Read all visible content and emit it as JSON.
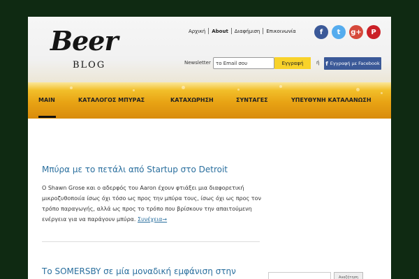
{
  "logo": {
    "main": "Beer",
    "sub": "BLOG"
  },
  "top_nav": {
    "items": [
      "Αρχική",
      "About",
      "Διαφήμιση",
      "Επικοινωνία"
    ],
    "active": "About"
  },
  "social": {
    "facebook": "f",
    "twitter": "t",
    "google_plus": "g+",
    "pinterest": "P"
  },
  "newsletter": {
    "label": "Newsletter",
    "email_value": "το Email σου",
    "register_label": "Εγγραφή",
    "or_label": "ή",
    "facebook_register_label": "Εγγραφή με Facebook"
  },
  "main_nav": {
    "items": [
      "MAIN",
      "ΚΑΤΑΛΟΓΟΣ ΜΠΥΡΑΣ",
      "ΚΑΤΑΧΩΡΗΣΗ",
      "ΣΥΝΤΑΓΕΣ",
      "ΥΠΕΥΘΥΝΗ ΚΑΤΑΛΑΝΩΣΗ"
    ],
    "active": "MAIN"
  },
  "post": {
    "title": "Μπύρα με το πετάλι από Startup στο Detroit",
    "excerpt": "Ο Shawn Grose και ο αδερφός του Aaron έχουν φτιάξει μια διαφορετική μικροζυθοποιία ίσως όχι τόσο ως προς την μπύρα τους, ίσως όχι ως προς τον τρόπο παραγωγής, αλλά ως προς το τρόπο που βρίσκουν την απαιτούμενη ενέργεια για να παράγουν μπύρα.",
    "read_more": "Συνέχεια→"
  },
  "post2": {
    "title": "Το SOMERSBY σε μία μοναδική εμφάνιση στην"
  },
  "search": {
    "button_label": "Αναζήτηση"
  },
  "colors": {
    "link": "#2a6f9e",
    "accent": "#f8d22a",
    "background": "#0f2a12",
    "facebook": "#3b5998"
  }
}
